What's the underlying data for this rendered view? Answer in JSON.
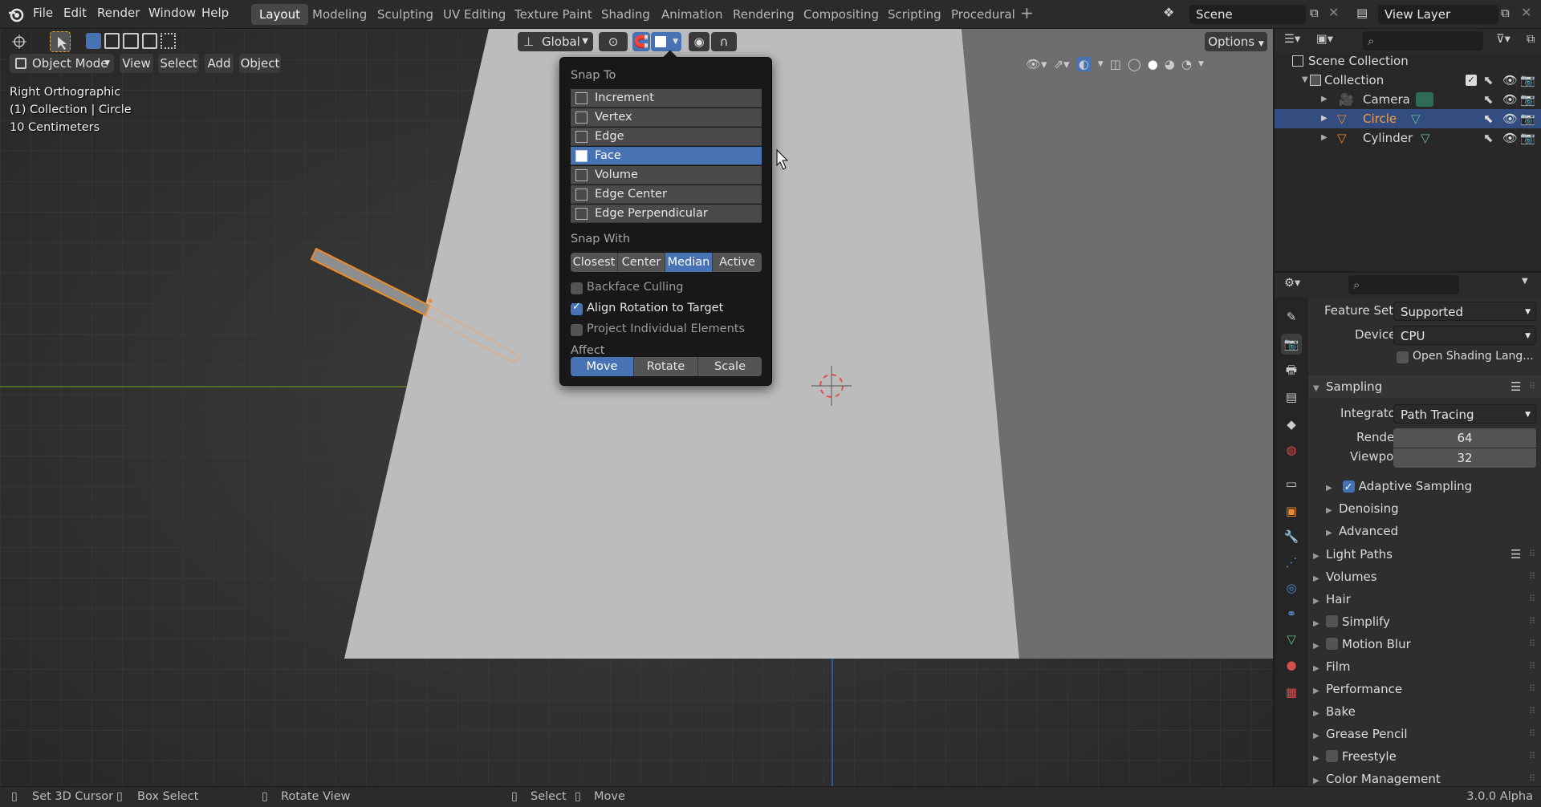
{
  "topbar": {
    "menus": [
      "File",
      "Edit",
      "Render",
      "Window",
      "Help"
    ],
    "workspaces": [
      "Layout",
      "Modeling",
      "Sculpting",
      "UV Editing",
      "Texture Paint",
      "Shading",
      "Animation",
      "Rendering",
      "Compositing",
      "Scripting",
      "Procedural"
    ],
    "active_workspace": "Layout",
    "scene": "Scene",
    "view_layer": "View Layer",
    "add_workspace": "+"
  },
  "viewport_header": {
    "mode": "Object Mode",
    "menus": [
      "View",
      "Select",
      "Add",
      "Object"
    ],
    "transform_orientation": "Global",
    "options": "Options"
  },
  "viewport_info": {
    "view": "Right Orthographic",
    "collection_object": "(1) Collection | Circle",
    "scale": "10 Centimeters"
  },
  "snap_popover": {
    "snap_to_label": "Snap To",
    "snap_to": [
      "Increment",
      "Vertex",
      "Edge",
      "Face",
      "Volume",
      "Edge Center",
      "Edge Perpendicular"
    ],
    "snap_to_selected": "Face",
    "snap_with_label": "Snap With",
    "snap_with": [
      "Closest",
      "Center",
      "Median",
      "Active"
    ],
    "snap_with_selected": "Median",
    "backface_culling": "Backface Culling",
    "align_rotation": "Align Rotation to Target",
    "project_individual": "Project Individual Elements",
    "affect_label": "Affect",
    "affect": [
      "Move",
      "Rotate",
      "Scale"
    ],
    "affect_selected": "Move"
  },
  "outliner": {
    "root": "Scene Collection",
    "collection": "Collection",
    "objects": [
      {
        "name": "Camera",
        "selected": false
      },
      {
        "name": "Circle",
        "selected": true
      },
      {
        "name": "Cylinder",
        "selected": false
      }
    ]
  },
  "properties": {
    "feature_set_label": "Feature Set",
    "feature_set": "Supported",
    "device_label": "Device",
    "device": "CPU",
    "osl": "Open Shading Lang...",
    "sampling": "Sampling",
    "integrator_label": "Integrator",
    "integrator": "Path Tracing",
    "render_label": "Render",
    "render_samples": "64",
    "viewport_label": "Viewport",
    "viewport_samples": "32",
    "adaptive_sampling": "Adaptive Sampling",
    "denoising": "Denoising",
    "advanced": "Advanced",
    "panels": [
      "Light Paths",
      "Volumes",
      "Hair",
      "Simplify",
      "Motion Blur",
      "Film",
      "Performance",
      "Bake",
      "Grease Pencil",
      "Freestyle",
      "Color Management"
    ]
  },
  "statusbar": {
    "set_cursor": "Set 3D Cursor",
    "box_select": "Box Select",
    "rotate_view": "Rotate View",
    "select": "Select",
    "move": "Move",
    "version": "3.0.0 Alpha"
  },
  "colors": {
    "accent": "#4772b3",
    "selected_object": "#e8892c",
    "ground_plane": "#bcbcbc"
  }
}
